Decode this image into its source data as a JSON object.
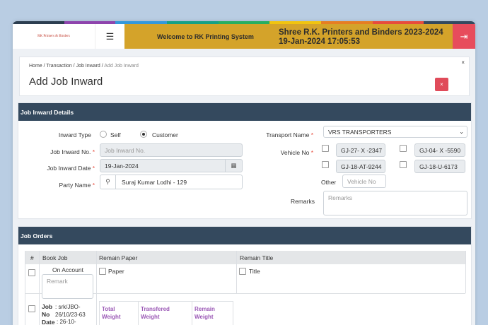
{
  "brand_colors": [
    "#2c3e50",
    "#8e44ad",
    "#3498db",
    "#16a085",
    "#27ae60",
    "#f1c40f",
    "#e67e22",
    "#e74c3c",
    "#34495e"
  ],
  "header": {
    "logo_text": "RK Printers & Binders",
    "menu_icon": "☰",
    "welcome": "Welcome to RK Printing System",
    "company_line1": "Shree R.K. Printers and Binders 2023-2024",
    "company_line2": "19-Jan-2024 17:05:53",
    "logout_icon": "⇥"
  },
  "breadcrumb": {
    "home": "Home",
    "sep": " / ",
    "transaction": "Transaction",
    "job_inward": "Job Inward",
    "current": "Add Job Inward"
  },
  "page": {
    "title": "Add Job Inward",
    "close_icon": "×",
    "corner_icon": "×"
  },
  "details": {
    "section_title": "Job Inward Details",
    "inward_type_label": "Inward Type",
    "type_options": [
      "Self",
      "Customer"
    ],
    "type_selected": "Customer",
    "job_no_label": "Job Inward No.",
    "job_no_placeholder": "Job Inward No.",
    "job_date_label": "Job Inward Date",
    "job_date_value": "19-Jan-2024",
    "calendar_icon": "▦",
    "party_label": "Party Name",
    "search_icon": "⚲",
    "party_value": "Suraj Kumar Lodhi - 129",
    "required_mark": "*",
    "transport_label": "Transport Name",
    "transport_value": "VRS TRANSPORTERS",
    "chevron": "⌄",
    "vehicle_label": "Vehicle No",
    "vehicles": [
      "GJ-27- X -2347",
      "GJ-04- X -5590",
      "GJ-18-AT-9244",
      "GJ-18-U-6173"
    ],
    "other_label": "Other",
    "other_placeholder": "Vehicle No",
    "remarks_label": "Remarks",
    "remarks_placeholder": "Remarks"
  },
  "orders": {
    "section_title": "Job Orders",
    "headers": [
      "#",
      "Book Job",
      "Remain Paper",
      "Remain Title"
    ],
    "on_account": "On Account",
    "remark_placeholder": "Remark",
    "paper_label": "Paper",
    "title_label": "Title",
    "job_no_label": "Job No",
    "job_no_value": ": srk/JBO-26/10/23-63",
    "date_label": "Date",
    "date_value": ": 26-10-",
    "inner_headers": [
      "Total Weight",
      "Transfered Weight",
      "Remain Weight"
    ]
  }
}
